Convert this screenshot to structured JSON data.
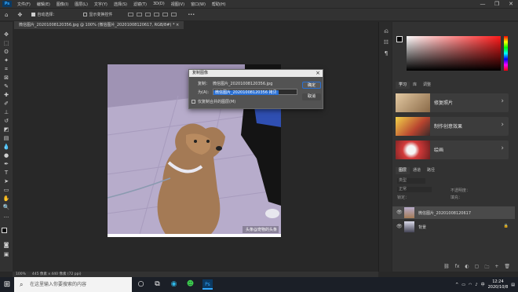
{
  "menu": {
    "app_logo": "Ps",
    "items": [
      "文件(F)",
      "编辑(E)",
      "图像(I)",
      "图层(L)",
      "文字(Y)",
      "选择(S)",
      "滤镜(T)",
      "3D(D)",
      "视图(V)",
      "窗口(W)",
      "帮助(H)"
    ]
  },
  "window_controls": {
    "minimize": "—",
    "maximize": "❐",
    "close": "✕"
  },
  "options": {
    "auto_select_label": "自动选择：",
    "transform_label": "显示变换控件",
    "more": "•••"
  },
  "document": {
    "tab_title": "微信图片_20201008120356.jpg @ 100% (微信图片_20201008120617, RGB/8#) *  ×"
  },
  "dialog": {
    "title": "复制图像",
    "close": "×",
    "source_label": "复制：",
    "source_value": "微信图片_20201008120356.jpg",
    "as_label": "为(A):",
    "as_value": "微信图片_20201008120356 拷贝",
    "merged_label": "仅复制合并的图层(M)",
    "ok_label": "确定",
    "cancel_label": "取消"
  },
  "watermark": "头条@宠物的头条",
  "learn_panel": {
    "tabs": [
      "学习",
      "库",
      "调整"
    ],
    "cards": [
      {
        "label": "修复照片",
        "chevron": "›",
        "thumb_color": "#c9a27a"
      },
      {
        "label": "制作创意效果",
        "chevron": "›",
        "thumb_color": "#b8442f"
      },
      {
        "label": "绘画",
        "chevron": "›",
        "thumb_color": "#d23a3a"
      }
    ]
  },
  "layers_panel": {
    "tabs": [
      "图层",
      "通道",
      "路径"
    ],
    "kind_label": "类型",
    "mode_label": "正常",
    "opacity_label": "不透明度：",
    "lock_label": "锁定：",
    "fill_label": "填充：",
    "layers": [
      {
        "name": "微信图片_20201008120617",
        "eye": "👁"
      },
      {
        "name": "背景",
        "eye": "👁"
      }
    ],
    "footer_icons": [
      "⛓",
      "fx",
      "◐",
      "▢",
      "🗀",
      "+",
      "🗑"
    ]
  },
  "status": {
    "zoom": "100%",
    "doc_size": "445 像素 x 440 像素 (72 ppi)"
  },
  "taskbar": {
    "search_placeholder": "在这里输入你要搜索的内容",
    "clock_time": "12:24",
    "clock_date": "2020/10/8"
  },
  "colors": {
    "accent_blue": "#2a70d4",
    "ps_blue": "#31a8ff",
    "panel_bg": "#323232",
    "canvas_bg": "#282828"
  }
}
